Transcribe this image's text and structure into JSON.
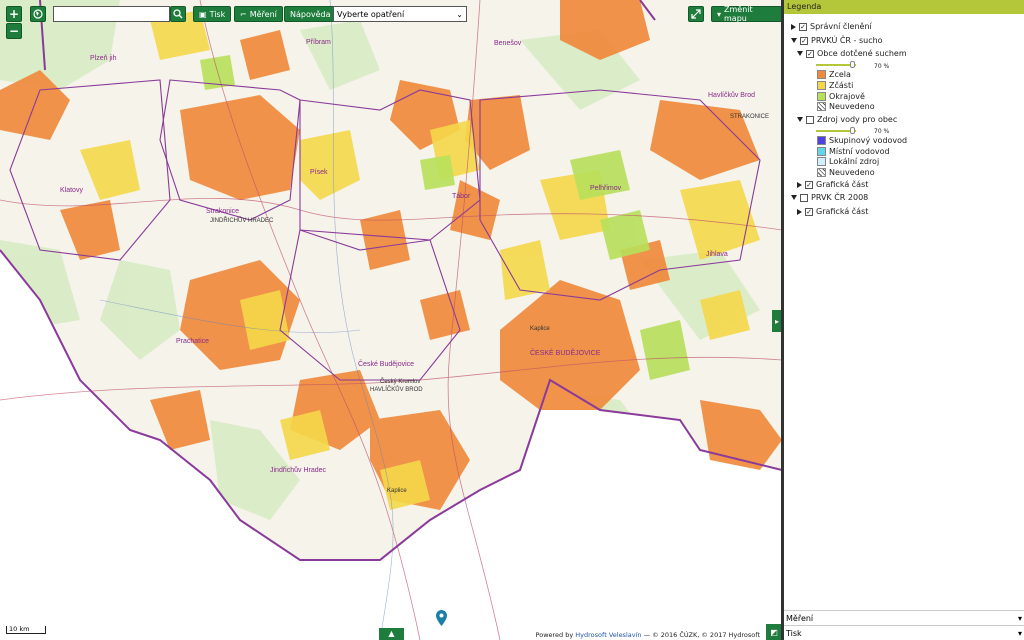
{
  "toolbar": {
    "zoom_in": "+",
    "zoom_out": "−",
    "globe_icon": "globe-icon",
    "search_value": "",
    "search_icon": "search-icon",
    "print_label": "Tisk",
    "measure_label": "Měření",
    "help_label": "Nápověda",
    "measure_select_value": "Vyberte opatření",
    "fullscreen_icon": "expand-icon",
    "change_map_label": "Změnit mapu"
  },
  "colors": {
    "accent": "#1e7d3c",
    "legend_header": "#b4c73b",
    "zcela": "#f08a3c",
    "zcasti": "#f5d84a",
    "okrajove": "#b8e05a",
    "skupinovy": "#5040e0",
    "mistni": "#60d8e8",
    "lokalni": "#d0f0ff",
    "boundary": "#8a3a9a"
  },
  "map": {
    "places": [
      "Plzeň jih",
      "Příbram",
      "Benešov",
      "Havlíčkův Brod",
      "Klatovy",
      "Písek",
      "Tábor",
      "Pelhřimov",
      "Strakonice",
      "Jihlava",
      "Prachatice",
      "České Budějovice",
      "ČESKÉ BUDĚJOVICE",
      "Jindřichův Hradec",
      "Český Krumlov",
      "HAVLÍČKŮV BROD",
      "STRAKONICE",
      "JINDŘICHŮV HRADEC",
      "Kaplice"
    ]
  },
  "legend": {
    "title": "Legenda",
    "items": [
      {
        "label": "Správní členění"
      },
      {
        "label": "PRVKÚ ČR - sucho"
      },
      {
        "label": "Obce dotčené suchem"
      },
      {
        "label": "70 %"
      },
      {
        "label": "Zcela"
      },
      {
        "label": "Zčásti"
      },
      {
        "label": "Okrajově"
      },
      {
        "label": "Neuvedeno"
      },
      {
        "label": "Zdroj vody pro obec"
      },
      {
        "label": "70 %"
      },
      {
        "label": "Skupinový vodovod"
      },
      {
        "label": "Místní vodovod"
      },
      {
        "label": "Lokální zdroj"
      },
      {
        "label": "Neuvedeno"
      },
      {
        "label": "Grafická část"
      },
      {
        "label": "PRVK ČR 2008"
      },
      {
        "label": "Grafická část"
      }
    ],
    "opacity_1": 0.7,
    "opacity_2": 0.7
  },
  "bottom_panels": [
    {
      "label": "Měření"
    },
    {
      "label": "Tisk"
    }
  ],
  "attribution": {
    "prefix": "Powered by",
    "link": "Hydrosoft Veleslavín",
    "rest": "— © 2016 ČÚZK, © 2017 Hydrosoft"
  },
  "scale_label": "10 km"
}
